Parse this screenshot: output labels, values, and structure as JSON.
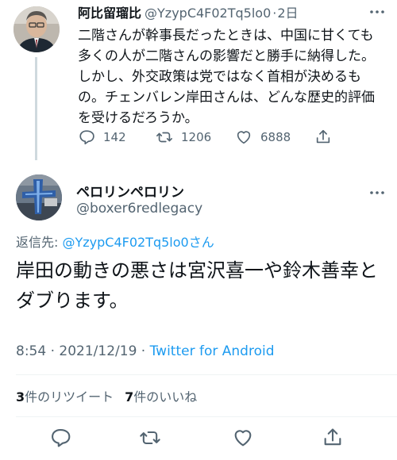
{
  "parent_tweet": {
    "display_name": "阿比留瑠比",
    "handle": "@YzypC4F02Tq5lo0",
    "separator": "·",
    "time": "2日",
    "text": "二階さんが幹事長だったときは、中国に甘くても多くの人が二階さんの影響だと勝手に納得した。しかし、外交政策は党ではなく首相が決めるもの。チェンバレン岸田さんは、どんな歴史的評価を受けるだろうか。",
    "reply_count": "142",
    "retweet_count": "1206",
    "like_count": "6888"
  },
  "main_tweet": {
    "display_name": "ペロリンペロリン",
    "handle": "@boxer6redlegacy",
    "reply_prefix": "返信先: ",
    "reply_target": "@YzypC4F02Tq5lo0",
    "reply_suffix": "さん",
    "text": "岸田の動きの悪さは宮沢喜一や鈴木善幸とダブります。",
    "time": "8:54",
    "dot": " · ",
    "date": "2021/12/19",
    "dot2": " · ",
    "client": "Twitter for Android",
    "retweet_num": "3",
    "retweet_label": "件のリツイート",
    "like_num": "7",
    "like_label": "件のいいね"
  },
  "icons": {
    "more": "more-icon",
    "reply": "reply-icon",
    "retweet": "retweet-icon",
    "like": "heart-icon",
    "share": "share-icon"
  },
  "colors": {
    "link": "#1d9bf0",
    "secondary_text": "#536471",
    "primary_text": "#0f1419",
    "thread_line": "#cfd9de"
  }
}
